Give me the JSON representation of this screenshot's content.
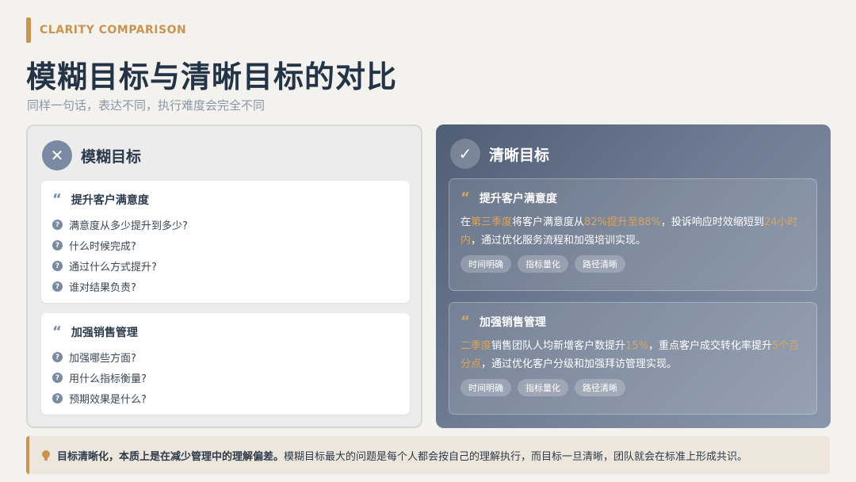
{
  "header": {
    "eyebrow": "CLARITY COMPARISON",
    "title": "模糊目标与清晰目标的对比",
    "subtitle": "同样一句话，表达不同，执行难度会完全不同"
  },
  "vague": {
    "icon": "close-icon",
    "label": "模糊目标",
    "cards": [
      {
        "title": "提升客户满意度",
        "questions": [
          "满意度从多少提升到多少?",
          "什么时候完成?",
          "通过什么方式提升?",
          "谁对结果负责?"
        ]
      },
      {
        "title": "加强销售管理",
        "questions": [
          "加强哪些方面?",
          "用什么指标衡量?",
          "预期效果是什么?"
        ]
      }
    ]
  },
  "clear": {
    "icon": "check-icon",
    "label": "清晰目标",
    "cards": [
      {
        "title": "提升客户满意度",
        "desc": {
          "p1": "在",
          "h1": "第三季度",
          "p2": "将客户满意度从",
          "h2": "82%提升至88%",
          "p3": "，投诉响应时效缩短到",
          "h3": "24小时内",
          "p4": "，通过优化服务流程和加强培训实现。"
        },
        "tags": [
          "时间明确",
          "指标量化",
          "路径清晰"
        ]
      },
      {
        "title": "加强销售管理",
        "desc": {
          "h1": "二季度",
          "p1": "销售团队人均新增客户数提升",
          "h2": "15%",
          "p2": "，重点客户成交转化率提升",
          "h3": "5个百分点",
          "p3": "，通过优化客户分级和加强拜访管理实现。"
        },
        "tags": [
          "时间明确",
          "指标量化",
          "路径清晰"
        ]
      }
    ]
  },
  "note": {
    "icon": "lightbulb-icon",
    "bold": "目标清晰化，本质上是在减少管理中的理解偏差。",
    "text": "模糊目标最大的问题是每个人都会按自己的理解执行，而目标一旦清晰，团队就会在标准上形成共识。"
  },
  "colors": {
    "accent": "#c9954e",
    "highlight": "#d9a55b",
    "title": "#243447",
    "vague_icon": "#7b8aa3",
    "clear_panel": "#5f6d85"
  }
}
